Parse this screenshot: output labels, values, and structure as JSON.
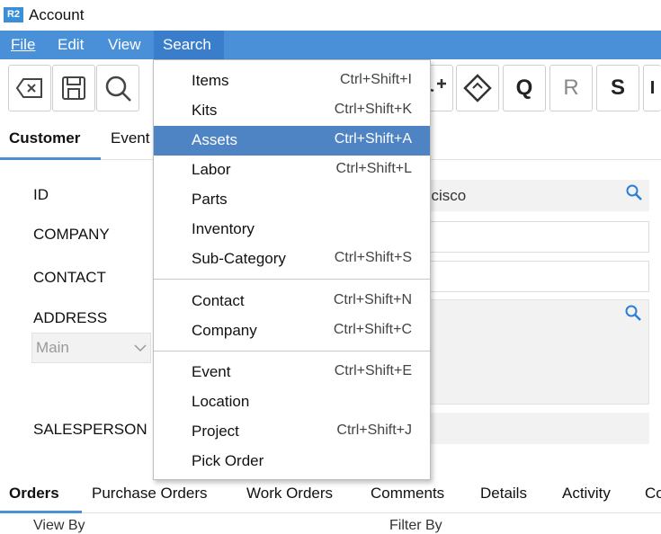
{
  "window": {
    "logo": "R2",
    "title": "Account"
  },
  "menubar": {
    "file": "File",
    "edit": "Edit",
    "view": "View",
    "search": "Search"
  },
  "toolbar": {
    "btn_q": "Q",
    "btn_r": "R",
    "btn_s": "S",
    "btn_partial": "I"
  },
  "top_tabs": {
    "customer": "Customer",
    "event": "Event"
  },
  "form": {
    "id_label": "ID",
    "id_value": "ncisco",
    "company_label": "COMPANY",
    "contact_label": "CONTACT",
    "address_label": "ADDRESS",
    "address_type": "Main",
    "salesperson_label": "SALESPERSON"
  },
  "bottom_tabs": [
    "Orders",
    "Purchase Orders",
    "Work Orders",
    "Comments",
    "Details",
    "Activity",
    "Co"
  ],
  "bottom_sub": {
    "view_by": "View By",
    "filter_by": "Filter By"
  },
  "search_menu": {
    "items": {
      "label": "Items",
      "shortcut": "Ctrl+Shift+I"
    },
    "kits": {
      "label": "Kits",
      "shortcut": "Ctrl+Shift+K"
    },
    "assets": {
      "label": "Assets",
      "shortcut": "Ctrl+Shift+A"
    },
    "labor": {
      "label": "Labor",
      "shortcut": "Ctrl+Shift+L"
    },
    "parts": {
      "label": "Parts",
      "shortcut": ""
    },
    "inventory": {
      "label": "Inventory",
      "shortcut": ""
    },
    "subcategory": {
      "label": "Sub-Category",
      "shortcut": "Ctrl+Shift+S"
    },
    "contact": {
      "label": "Contact",
      "shortcut": "Ctrl+Shift+N"
    },
    "company": {
      "label": "Company",
      "shortcut": "Ctrl+Shift+C"
    },
    "event": {
      "label": "Event",
      "shortcut": "Ctrl+Shift+E"
    },
    "location": {
      "label": "Location",
      "shortcut": ""
    },
    "project": {
      "label": "Project",
      "shortcut": "Ctrl+Shift+J"
    },
    "pick_order": {
      "label": "Pick Order",
      "shortcut": ""
    }
  },
  "colors": {
    "accent": "#4a90d9",
    "highlight": "#4f84c4",
    "search_icon": "#2a7fd4"
  }
}
